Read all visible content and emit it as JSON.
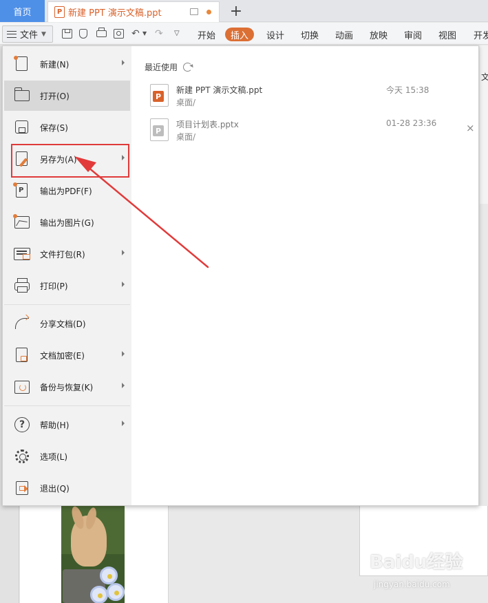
{
  "titlebar": {
    "home_tab": "首页",
    "doc_tab_title": "新建 PPT 演示文稿.ppt",
    "new_tab_symbol": "+"
  },
  "toolbar": {
    "file_button": "文件",
    "ribbon_tabs": [
      {
        "label": "开始",
        "active": false
      },
      {
        "label": "插入",
        "active": true
      },
      {
        "label": "设计",
        "active": false
      },
      {
        "label": "切换",
        "active": false
      },
      {
        "label": "动画",
        "active": false
      },
      {
        "label": "放映",
        "active": false
      },
      {
        "label": "审阅",
        "active": false
      },
      {
        "label": "视图",
        "active": false
      },
      {
        "label": "开发",
        "active": false
      }
    ],
    "accent_color": "#dc6f34"
  },
  "file_menu": {
    "items": [
      {
        "label": "新建(N)",
        "icon": "new-document-icon",
        "has_submenu": true
      },
      {
        "label": "打开(O)",
        "icon": "folder-open-icon",
        "has_submenu": false,
        "hovered": true
      },
      {
        "label": "保存(S)",
        "icon": "save-icon",
        "has_submenu": false
      },
      {
        "label": "另存为(A)",
        "icon": "save-as-icon",
        "has_submenu": true,
        "highlighted": true
      },
      {
        "label": "输出为PDF(F)",
        "icon": "export-pdf-icon",
        "has_submenu": false
      },
      {
        "label": "输出为图片(G)",
        "icon": "export-image-icon",
        "has_submenu": false
      },
      {
        "label": "文件打包(R)",
        "icon": "package-icon",
        "has_submenu": true
      },
      {
        "label": "打印(P)",
        "icon": "printer-icon",
        "has_submenu": true
      },
      {
        "label": "分享文档(D)",
        "icon": "share-icon",
        "has_submenu": false
      },
      {
        "label": "文档加密(E)",
        "icon": "encrypt-icon",
        "has_submenu": true
      },
      {
        "label": "备份与恢复(K)",
        "icon": "backup-restore-icon",
        "has_submenu": true
      },
      {
        "label": "帮助(H)",
        "icon": "help-icon",
        "has_submenu": true
      },
      {
        "label": "选项(L)",
        "icon": "gear-icon",
        "has_submenu": false
      },
      {
        "label": "退出(Q)",
        "icon": "exit-icon",
        "has_submenu": false
      }
    ]
  },
  "recent": {
    "title": "最近使用",
    "files": [
      {
        "name": "新建 PPT 演示文稿.ppt",
        "path": "桌面/",
        "time": "今天 15:38",
        "badge": "P",
        "badge_color": "#d9622b"
      },
      {
        "name": "项目计划表.pptx",
        "path": "桌面/",
        "time": "01-28 23:36",
        "badge": "P",
        "badge_color": "#bdbdbd"
      }
    ],
    "remove_symbol": "×"
  },
  "background": {
    "right_edge_char": "文"
  },
  "watermark": {
    "brand": "Baidu经验",
    "url": "jingyan.baidu.com"
  }
}
